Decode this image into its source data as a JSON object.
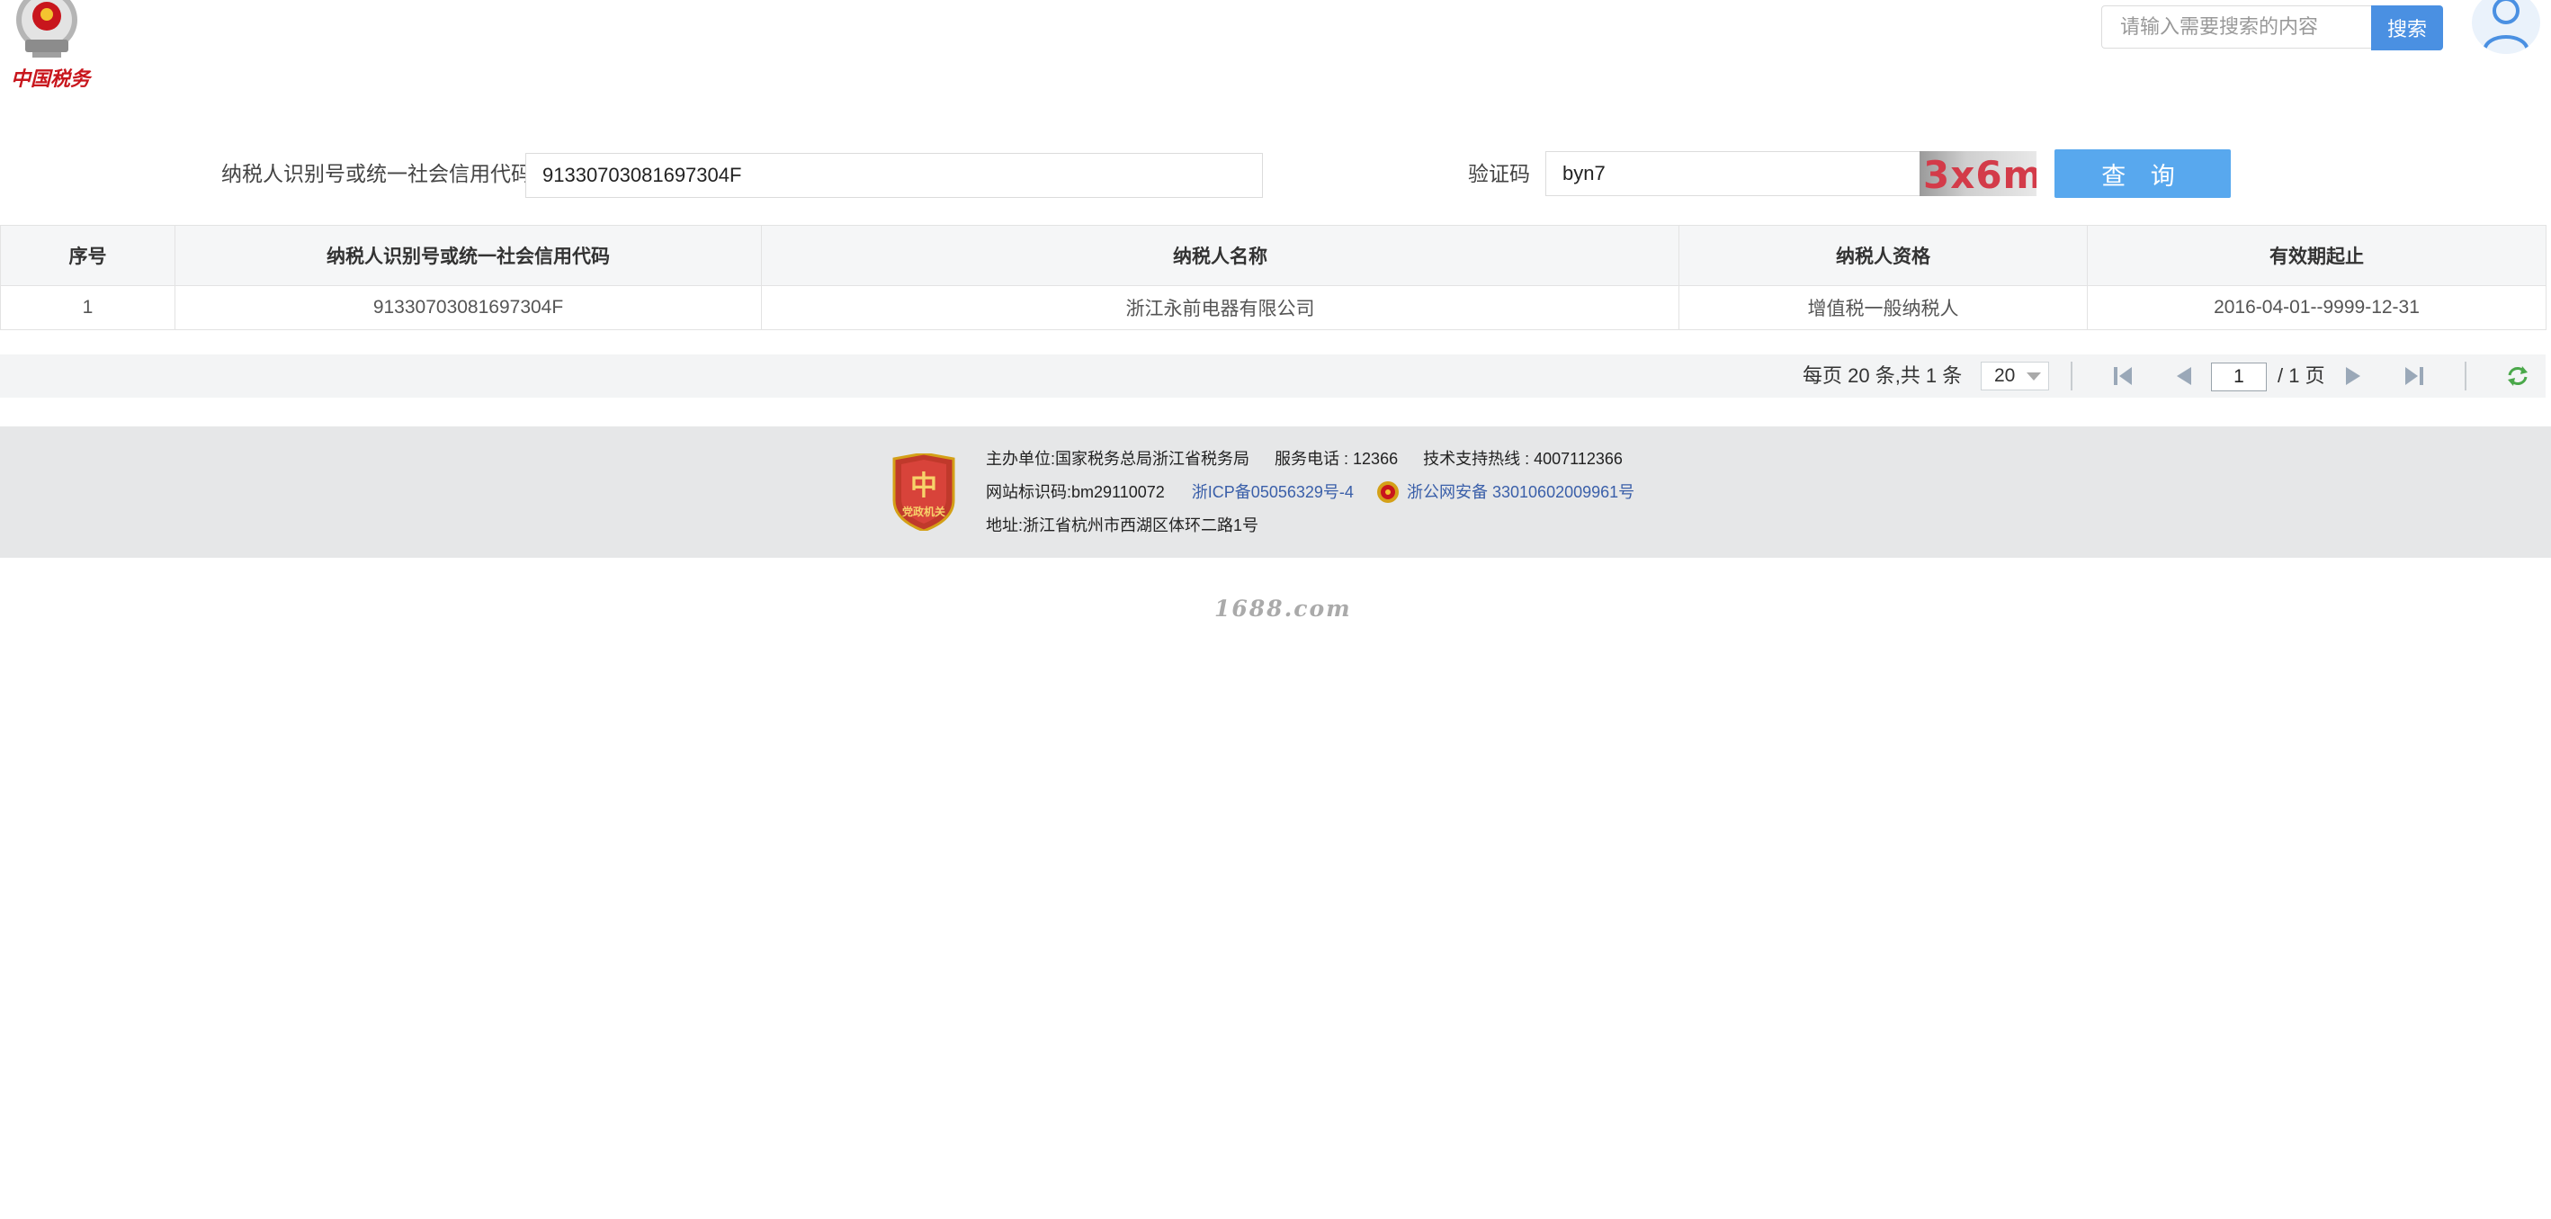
{
  "header": {
    "logo_text": "中国税务",
    "search": {
      "placeholder": "请输入需要搜索的内容",
      "button_label": "搜索"
    }
  },
  "query_form": {
    "taxpayer_id_label": "纳税人识别号或统一社会信用代码",
    "taxpayer_id_value": "91330703081697304F",
    "captcha_label": "验证码",
    "captcha_value": "byn7",
    "captcha_image_text": "3x6m",
    "query_button_label": "查 询"
  },
  "table": {
    "headers": [
      "序号",
      "纳税人识别号或统一社会信用代码",
      "纳税人名称",
      "纳税人资格",
      "有效期起止"
    ],
    "rows": [
      [
        "1",
        "91330703081697304F",
        "浙江永前电器有限公司",
        "增值税一般纳税人",
        "2016-04-01--9999-12-31"
      ]
    ]
  },
  "pagination": {
    "summary": "每页 20 条,共 1 条",
    "page_size": "20",
    "current_page": "1",
    "total_pages_label": "/ 1 页"
  },
  "footer": {
    "badge_text": "党政机关",
    "sponsor": "主办单位:国家税务总局浙江省税务局",
    "service_phone": "服务电话 : 12366",
    "support_hotline": "技术支持热线 : 4007112366",
    "site_id": "网站标识码:bm29110072",
    "icp": "浙ICP备05056329号-4",
    "police_record": "浙公网安备 33010602009961号",
    "address": "地址:浙江省杭州市西湖区体环二路1号"
  },
  "watermark": "1688.com",
  "colors": {
    "accent_blue": "#4a90e2",
    "query_blue": "#58a8ee",
    "captcha_red": "#d33b49",
    "logo_red": "#c8161d",
    "footer_bg": "#e6e7e8",
    "link_blue": "#3a5fa9"
  },
  "icons": {
    "logo": "tax-emblem-icon",
    "user": "user-icon",
    "first_page": "first-page-icon",
    "prev_page": "prev-page-icon",
    "next_page": "next-page-icon",
    "last_page": "last-page-icon",
    "refresh": "refresh-icon",
    "badge": "party-gov-badge-icon",
    "police": "police-emblem-icon"
  }
}
